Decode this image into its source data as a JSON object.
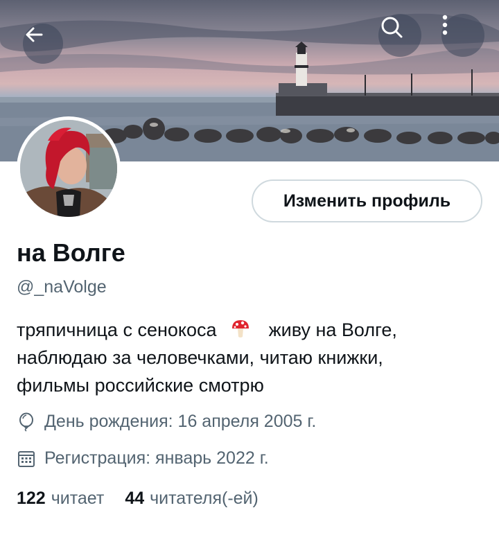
{
  "profile": {
    "display_name": "на Волге",
    "handle": "@_naVolge",
    "edit_button_label": "Изменить профиль",
    "bio_lines": [
      "тряпичница с сенокоса",
      "живу на Волге,",
      "наблюдаю за человечками, читаю книжки,",
      "фильмы российские смотрю"
    ],
    "bio_emoji_icon": "mushroom-icon",
    "birthday": "День рождения: 16 апреля 2005 г.",
    "joined": "Регистрация: январь 2022 г.",
    "following_count": "122",
    "following_label": "читает",
    "followers_count": "44",
    "followers_label": "читателя(-ей)"
  },
  "header_icons": [
    "back-arrow-icon",
    "search-icon",
    "more-vertical-icon"
  ],
  "colors": {
    "text_primary": "#0f1419",
    "text_secondary": "#536471",
    "button_border": "#cfd9de"
  }
}
